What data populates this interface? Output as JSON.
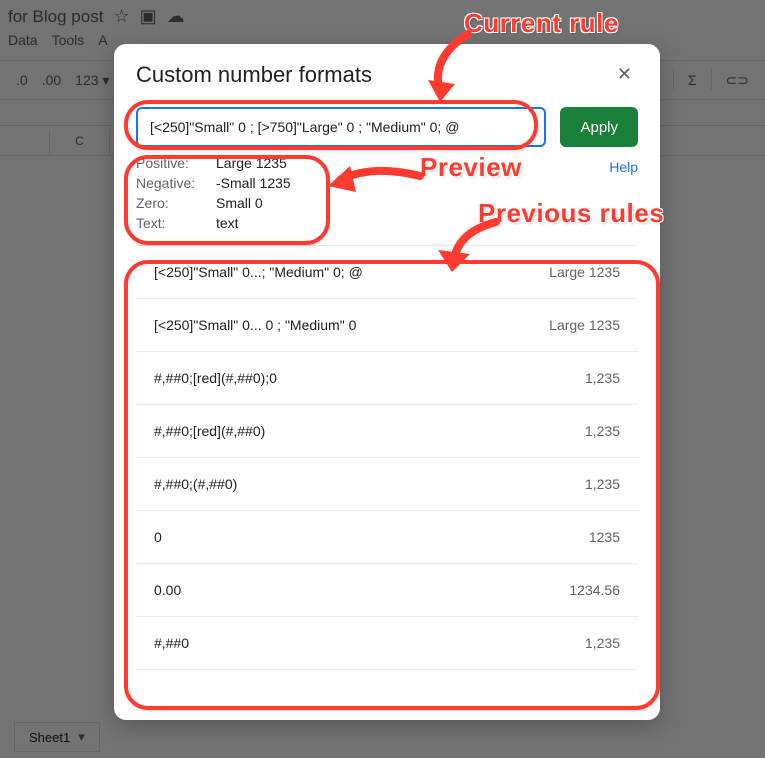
{
  "window": {
    "doc_title": "for Blog post"
  },
  "menubar": [
    "Data",
    "Tools",
    "A"
  ],
  "toolbar": {
    "decimal_remove": ".0",
    "decimal_add": ".00",
    "num_format": "123"
  },
  "toolbar_right": {
    "filter": "▼",
    "sigma": "Σ",
    "link": "⊂⊃"
  },
  "sheettab": {
    "name": "Sheet1"
  },
  "dialog": {
    "title": "Custom number formats",
    "format_value": "[<250]\"Small\" 0 ; [>750]\"Large\" 0 ; \"Medium\" 0; @",
    "apply_label": "Apply",
    "help_label": "Help",
    "preview": {
      "positive_label": "Positive:",
      "positive_value": "Large 1235",
      "negative_label": "Negative:",
      "negative_value": "-Small 1235",
      "zero_label": "Zero:",
      "zero_value": "Small 0",
      "text_label": "Text:",
      "text_value": "text"
    },
    "rules": [
      {
        "code": "[<250]\"Small\" 0...; \"Medium\" 0; @",
        "sample": "Large 1235"
      },
      {
        "code": "[<250]\"Small\" 0... 0 ; \"Medium\" 0",
        "sample": "Large 1235"
      },
      {
        "code": "#,##0;[red](#,##0);0",
        "sample": "1,235"
      },
      {
        "code": "#,##0;[red](#,##0)",
        "sample": "1,235"
      },
      {
        "code": "#,##0;(#,##0)",
        "sample": "1,235"
      },
      {
        "code": "0",
        "sample": "1235"
      },
      {
        "code": "0.00",
        "sample": "1234.56"
      },
      {
        "code": "#,##0",
        "sample": "1,235"
      }
    ]
  },
  "annotations": {
    "current_rule": "Current rule",
    "preview": "Preview",
    "previous_rules": "Previous rules"
  },
  "colheads": [
    "",
    "C"
  ]
}
